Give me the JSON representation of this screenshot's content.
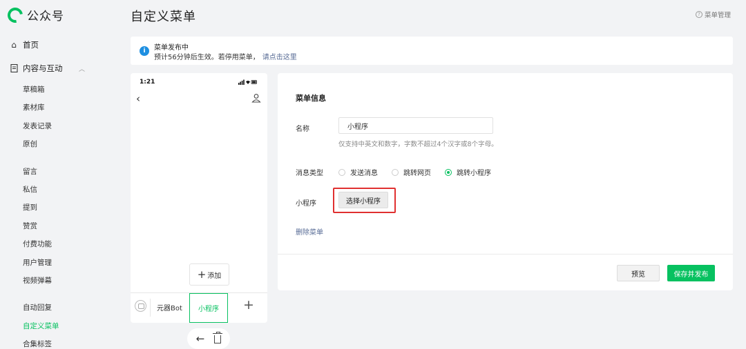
{
  "brand": {
    "name": "公众号",
    "accent": "#07c160"
  },
  "sidebar": {
    "home": {
      "label": "首页",
      "icon": "home-icon"
    },
    "content": {
      "label": "内容与互动",
      "icon": "document-icon"
    },
    "items": [
      {
        "label": "草稿箱"
      },
      {
        "label": "素材库"
      },
      {
        "label": "发表记录"
      },
      {
        "label": "原创"
      },
      {
        "label": "留言"
      },
      {
        "label": "私信"
      },
      {
        "label": "提到"
      },
      {
        "label": "赞赏"
      },
      {
        "label": "付费功能"
      },
      {
        "label": "用户管理"
      },
      {
        "label": "视频弹幕"
      },
      {
        "label": "自动回复"
      },
      {
        "label": "自定义菜单",
        "active": true
      },
      {
        "label": "合集标签"
      }
    ]
  },
  "header": {
    "title": "自定义菜单",
    "help": "菜单管理"
  },
  "notice": {
    "title": "菜单发布中",
    "text": "预计56分钟后生效。若停用菜单，",
    "link": "请点击这里"
  },
  "phone": {
    "time": "1:21",
    "add_label": "添加",
    "menu_items": [
      "元器Bot",
      "小程序"
    ],
    "selected_menu": "小程序"
  },
  "editor": {
    "section_title": "菜单信息",
    "name_label": "名称",
    "name_value": "小程序",
    "name_hint": "仅支持中英文和数字，字数不超过4个汉字或8个字母。",
    "type_label": "消息类型",
    "type_options": [
      "发送消息",
      "跳转网页",
      "跳转小程序"
    ],
    "type_selected": "跳转小程序",
    "mini_label": "小程序",
    "choose_button": "选择小程序",
    "delete_link": "删除菜单",
    "preview_button": "预览",
    "save_button": "保存并发布"
  }
}
